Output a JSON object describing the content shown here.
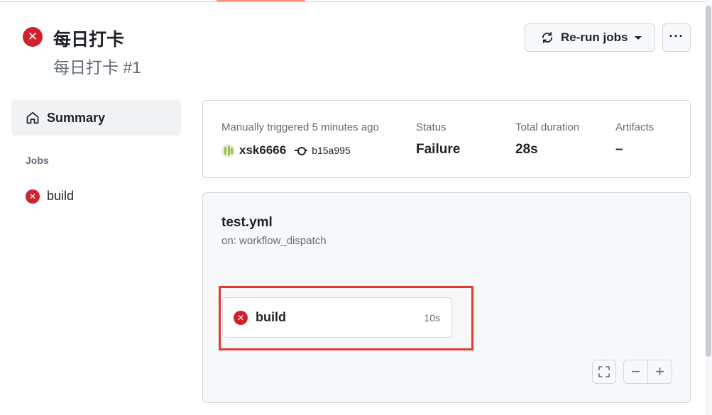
{
  "header": {
    "title": "每日打卡",
    "subtitle": "每日打卡 #1",
    "status_icon": "x-circle-icon",
    "status_color": "#cf222e",
    "rerun_label": "Re-run jobs",
    "more_label": "···"
  },
  "sidebar": {
    "summary_label": "Summary",
    "jobs_heading": "Jobs",
    "jobs": [
      {
        "label": "build",
        "status": "failure"
      }
    ]
  },
  "summary": {
    "trigger_label": "Manually triggered 5 minutes ago",
    "actor": "xsk6666",
    "commit": "b15a995",
    "status_label": "Status",
    "status_value": "Failure",
    "duration_label": "Total duration",
    "duration_value": "28s",
    "artifacts_label": "Artifacts",
    "artifacts_value": "–"
  },
  "workflow": {
    "file": "test.yml",
    "trigger": "on: workflow_dispatch",
    "job": {
      "name": "build",
      "duration": "10s",
      "status": "failure"
    }
  },
  "colors": {
    "failure": "#cf222e",
    "highlight": "#e53935",
    "tab_accent": "#fd8c73"
  }
}
